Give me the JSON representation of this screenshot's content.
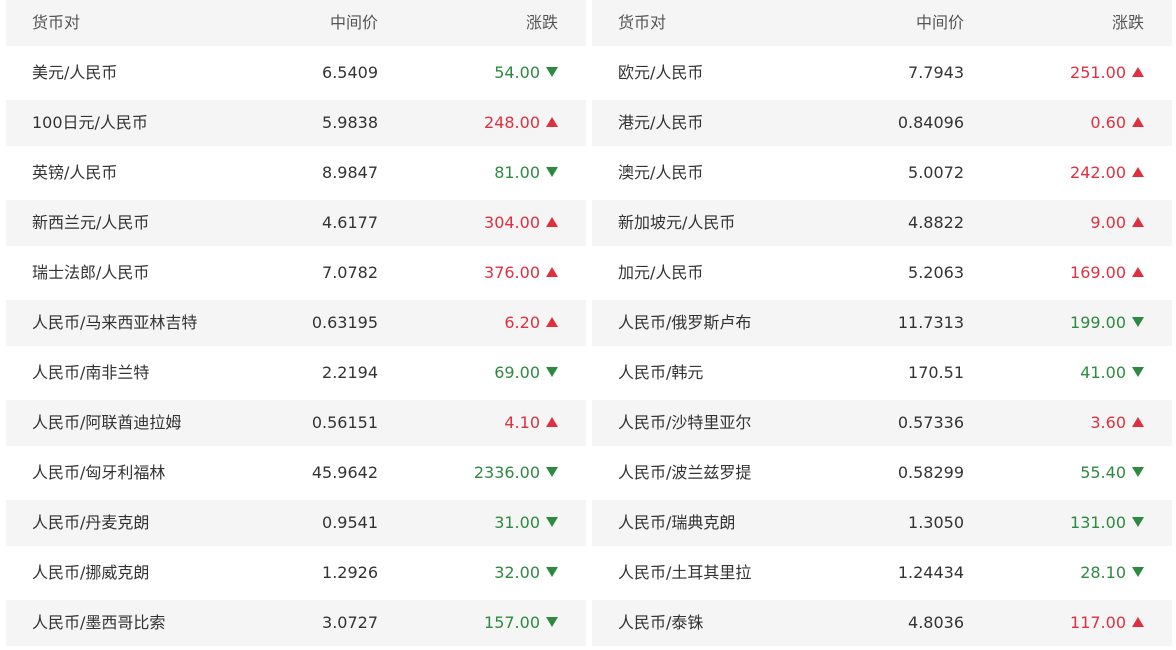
{
  "headers": {
    "pair": "货币对",
    "mid": "中间价",
    "change": "涨跌"
  },
  "colors": {
    "up": "#e0303f",
    "down": "#2e8a40",
    "row_shade": "#f5f5f5"
  },
  "icons": {
    "up": "triangle-up-icon",
    "down": "triangle-down-icon"
  },
  "left": [
    {
      "pair": "美元/人民币",
      "mid": "6.5409",
      "change": "54.00",
      "dir": "down"
    },
    {
      "pair": "100日元/人民币",
      "mid": "5.9838",
      "change": "248.00",
      "dir": "up"
    },
    {
      "pair": "英镑/人民币",
      "mid": "8.9847",
      "change": "81.00",
      "dir": "down"
    },
    {
      "pair": "新西兰元/人民币",
      "mid": "4.6177",
      "change": "304.00",
      "dir": "up"
    },
    {
      "pair": "瑞士法郎/人民币",
      "mid": "7.0782",
      "change": "376.00",
      "dir": "up"
    },
    {
      "pair": "人民币/马来西亚林吉特",
      "mid": "0.63195",
      "change": "6.20",
      "dir": "up"
    },
    {
      "pair": "人民币/南非兰特",
      "mid": "2.2194",
      "change": "69.00",
      "dir": "down"
    },
    {
      "pair": "人民币/阿联酋迪拉姆",
      "mid": "0.56151",
      "change": "4.10",
      "dir": "up"
    },
    {
      "pair": "人民币/匈牙利福林",
      "mid": "45.9642",
      "change": "2336.00",
      "dir": "down"
    },
    {
      "pair": "人民币/丹麦克朗",
      "mid": "0.9541",
      "change": "31.00",
      "dir": "down"
    },
    {
      "pair": "人民币/挪威克朗",
      "mid": "1.2926",
      "change": "32.00",
      "dir": "down"
    },
    {
      "pair": "人民币/墨西哥比索",
      "mid": "3.0727",
      "change": "157.00",
      "dir": "down"
    }
  ],
  "right": [
    {
      "pair": "欧元/人民币",
      "mid": "7.7943",
      "change": "251.00",
      "dir": "up"
    },
    {
      "pair": "港元/人民币",
      "mid": "0.84096",
      "change": "0.60",
      "dir": "up"
    },
    {
      "pair": "澳元/人民币",
      "mid": "5.0072",
      "change": "242.00",
      "dir": "up"
    },
    {
      "pair": "新加坡元/人民币",
      "mid": "4.8822",
      "change": "9.00",
      "dir": "up"
    },
    {
      "pair": "加元/人民币",
      "mid": "5.2063",
      "change": "169.00",
      "dir": "up"
    },
    {
      "pair": "人民币/俄罗斯卢布",
      "mid": "11.7313",
      "change": "199.00",
      "dir": "down"
    },
    {
      "pair": "人民币/韩元",
      "mid": "170.51",
      "change": "41.00",
      "dir": "down"
    },
    {
      "pair": "人民币/沙特里亚尔",
      "mid": "0.57336",
      "change": "3.60",
      "dir": "up"
    },
    {
      "pair": "人民币/波兰兹罗提",
      "mid": "0.58299",
      "change": "55.40",
      "dir": "down"
    },
    {
      "pair": "人民币/瑞典克朗",
      "mid": "1.3050",
      "change": "131.00",
      "dir": "down"
    },
    {
      "pair": "人民币/土耳其里拉",
      "mid": "1.24434",
      "change": "28.10",
      "dir": "down"
    },
    {
      "pair": "人民币/泰铢",
      "mid": "4.8036",
      "change": "117.00",
      "dir": "up"
    }
  ]
}
